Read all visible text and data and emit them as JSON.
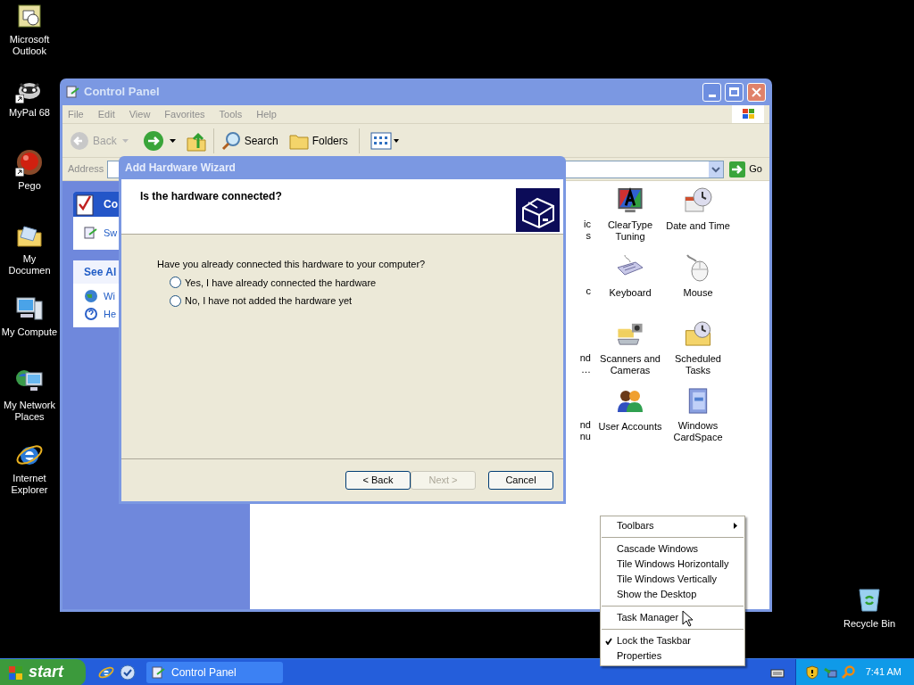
{
  "desktop_icons": [
    {
      "label": "Microsoft Outlook",
      "kind": "mail",
      "shortcut": false
    },
    {
      "label": "MyPal 68",
      "kind": "raccoon",
      "shortcut": true
    },
    {
      "label": "Pego",
      "kind": "ball",
      "shortcut": true
    },
    {
      "label": "My Documen",
      "kind": "folder",
      "shortcut": false
    },
    {
      "label": "My Compute",
      "kind": "computer",
      "shortcut": false
    },
    {
      "label": "My Network Places",
      "kind": "network",
      "shortcut": false
    },
    {
      "label": "Internet Explorer",
      "kind": "browser",
      "shortcut": false
    }
  ],
  "recycle_bin": {
    "label": "Recycle Bin"
  },
  "control_panel": {
    "title": "Control Panel",
    "active": false,
    "menu": [
      "File",
      "Edit",
      "View",
      "Favorites",
      "Tools",
      "Help"
    ],
    "toolbar": {
      "back": "Back",
      "search": "Search",
      "folders": "Folders"
    },
    "address": {
      "label": "Address",
      "go": "Go"
    },
    "task_pane": {
      "header": "Co",
      "links": [
        "Sw"
      ],
      "see_also": "See Al",
      "see_also_links": [
        "Wi",
        "He"
      ]
    },
    "icons": [
      {
        "lines": [
          "ic",
          "s"
        ],
        "kind": "partial"
      },
      {
        "lines": [
          "ClearType",
          "Tuning"
        ],
        "kind": "cleartype"
      },
      {
        "lines": [
          "Date and Time"
        ],
        "kind": "clock"
      },
      {
        "lines": [
          "c"
        ],
        "kind": "partial"
      },
      {
        "lines": [
          "Keyboard"
        ],
        "kind": "keyboard"
      },
      {
        "lines": [
          "Mouse"
        ],
        "kind": "mouse"
      },
      {
        "lines": [
          "nd",
          "…"
        ],
        "kind": "partial"
      },
      {
        "lines": [
          "Scanners and",
          "Cameras"
        ],
        "kind": "scanner"
      },
      {
        "lines": [
          "Scheduled",
          "Tasks"
        ],
        "kind": "tasks"
      },
      {
        "lines": [
          "nd",
          "nu"
        ],
        "kind": "partial"
      },
      {
        "lines": [
          "User Accounts"
        ],
        "kind": "users"
      },
      {
        "lines": [
          "Windows",
          "CardSpace"
        ],
        "kind": "cardspace"
      }
    ]
  },
  "wizard": {
    "title": "Add Hardware Wizard",
    "active": true,
    "heading": "Is the hardware connected?",
    "question": "Have you already connected this hardware to your computer?",
    "options": [
      {
        "label": "Yes, I have already connected the hardware",
        "selected": false
      },
      {
        "label": "No, I have not added the hardware yet",
        "selected": false
      }
    ],
    "buttons": [
      {
        "label": "< Back",
        "disabled": false
      },
      {
        "label": "Next >",
        "disabled": true
      },
      {
        "label": "Cancel",
        "disabled": false
      }
    ]
  },
  "context_menu": {
    "items": [
      {
        "kind": "submenu",
        "label": "Toolbars",
        "checked": false
      },
      {
        "kind": "separator"
      },
      {
        "kind": "item",
        "label": "Cascade Windows",
        "checked": false
      },
      {
        "kind": "item",
        "label": "Tile Windows Horizontally",
        "checked": false
      },
      {
        "kind": "item",
        "label": "Tile Windows Vertically",
        "checked": false
      },
      {
        "kind": "item",
        "label": "Show the Desktop",
        "checked": false
      },
      {
        "kind": "separator"
      },
      {
        "kind": "item",
        "label": "Task Manager",
        "checked": false
      },
      {
        "kind": "separator"
      },
      {
        "kind": "item",
        "label": "Lock the Taskbar",
        "checked": true
      },
      {
        "kind": "item",
        "label": "Properties",
        "checked": false
      }
    ]
  },
  "taskbar": {
    "start": "start",
    "tasks": [
      {
        "label": "Control Panel",
        "selected": false
      }
    ],
    "clock": "7:41 AM"
  }
}
